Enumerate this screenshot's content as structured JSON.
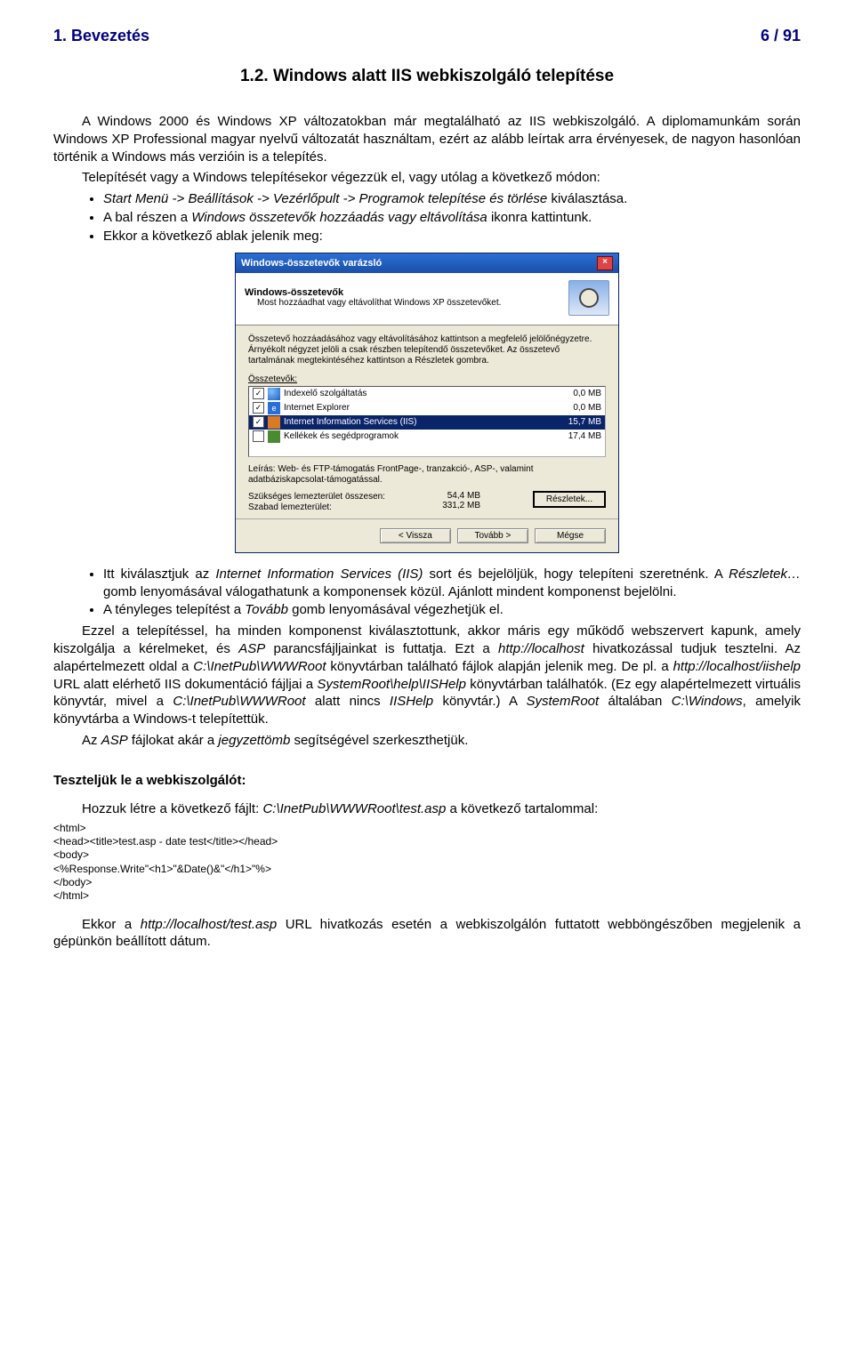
{
  "header": {
    "left": "1. Bevezetés",
    "right": "6 / 91"
  },
  "section_title": "1.2. Windows alatt IIS webkiszolgáló telepítése",
  "intro_p1": "A Windows 2000 és Windows XP változatokban már megtalálható az IIS webkiszolgáló. A diplomamunkám során Windows XP Professional magyar nyelvű változatát használtam, ezért az alább leírtak arra érvényesek, de nagyon hasonlóan történik a Windows más verzióin is a telepítés.",
  "intro_p2": "Telepítését vagy a Windows telepítésekor végezzük el, vagy utólag a következő módon:",
  "bullets1": {
    "b1_pre": "Start Menü -> Beállítások -> Vezérlőpult -> Programok telepítése és törlése",
    "b1_post": " kiválasztása.",
    "b2_pre": "A bal részen a ",
    "b2_i": "Windows összetevők hozzáadás vagy eltávolítása",
    "b2_post": " ikonra kattintunk.",
    "b3": "Ekkor a következő ablak jelenik meg:"
  },
  "wizard": {
    "title": "Windows-összetevők varázsló",
    "header_title": "Windows-összetevők",
    "header_sub": "Most hozzáadhat vagy eltávolíthat Windows XP összetevőket.",
    "hint": "Összetevő hozzáadásához vagy eltávolításához kattintson a megfelelő jelölőnégyzetre. Árnyékolt négyzet jelöli a csak részben telepítendő összetevőket. Az összetevő tartalmának megtekintéséhez kattintson a Részletek gombra.",
    "list_label": "Összetevők:",
    "rows": [
      {
        "checked": true,
        "icon": "globe",
        "name": "Indexelő szolgáltatás",
        "size": "0,0 MB"
      },
      {
        "checked": true,
        "icon": "e",
        "name": "Internet Explorer",
        "size": "0,0 MB"
      },
      {
        "checked": true,
        "icon": "box",
        "name": "Internet Information Services (IIS)",
        "size": "15,7 MB",
        "selected": true
      },
      {
        "checked": false,
        "icon": "tool",
        "name": "Kellékek és segédprogramok",
        "size": "17,4 MB"
      }
    ],
    "desc": "Leírás:  Web- és FTP-támogatás FrontPage-, tranzakció-, ASP-, valamint adatbáziskapcsolat-támogatással.",
    "req_label": "Szükséges lemezterület összesen:",
    "req_val": "54,4 MB",
    "free_label": "Szabad lemezterület:",
    "free_val": "331,2 MB",
    "btn_details": "Részletek...",
    "btn_back": "< Vissza",
    "btn_next": "Tovább >",
    "btn_cancel": "Mégse"
  },
  "bullets2": {
    "b1_a": "Itt kiválasztjuk az ",
    "b1_i1": "Internet Information Services (IIS)",
    "b1_b": " sort és bejelöljük, hogy telepíteni szeretnénk. A ",
    "b1_i2": "Részletek…",
    "b1_c": " gomb lenyomásával válogathatunk a komponensek közül. Ajánlott mindent komponenst bejelölni.",
    "b2_a": "A tényleges telepítést a ",
    "b2_i": "Tovább",
    "b2_b": " gomb lenyomásával végezhetjük el."
  },
  "para2_a": "Ezzel a telepítéssel, ha minden komponenst kiválasztottunk, akkor máris egy működő webszervert kapunk, amely kiszolgálja a kérelmeket, és ",
  "para2_i1": "ASP",
  "para2_b": " parancsfájljainkat is futtatja. Ezt a ",
  "para2_i2": "http://localhost",
  "para2_c": " hivatkozással tudjuk tesztelni. Az alapértelmezett oldal a ",
  "para2_i3": "C:\\InetPub\\WWWRoot",
  "para2_d": " könyvtárban található fájlok alapján jelenik meg. De pl. a ",
  "para2_i4": "http://localhost/iishelp",
  "para2_e": " URL alatt elérhető IIS dokumentáció fájljai a ",
  "para2_i5": "SystemRoot\\help\\IISHelp",
  "para2_f": " könyvtárban találhatók. (Ez egy alapértelmezett virtuális könyvtár, mivel a ",
  "para2_i6": "C:\\InetPub\\WWWRoot",
  "para2_g": " alatt nincs ",
  "para2_i7": "IISHelp",
  "para2_h": " könyvtár.) A ",
  "para2_i8": "SystemRoot",
  "para2_j": " általában ",
  "para2_i9": "C:\\Windows",
  "para2_k": ", amelyik könyvtárba a Windows-t telepítettük.",
  "para3_a": "Az ",
  "para3_i1": "ASP",
  "para3_b": " fájlokat akár a ",
  "para3_i2": "jegyzettömb",
  "para3_c": " segítségével szerkeszthetjük.",
  "subhead": "Teszteljük le a webkiszolgálót:",
  "para4_a": "Hozzuk létre a következő fájlt: ",
  "para4_i": "C:\\InetPub\\WWWRoot\\test.asp",
  "para4_b": " a következő tartalommal:",
  "code": {
    "l1": "<html>",
    "l2": "<head><title>test.asp - date test</title></head>",
    "l3": "<body>",
    "l4": "<%Response.Write\"<h1>\"&Date()&\"</h1>\"%>",
    "l5": "</body>",
    "l6": "</html>"
  },
  "para5_a": "Ekkor a ",
  "para5_i": "http://localhost/test.asp",
  "para5_b": " URL hivatkozás esetén a webkiszolgálón futtatott webböngészőben megjelenik a gépünkön beállított dátum."
}
